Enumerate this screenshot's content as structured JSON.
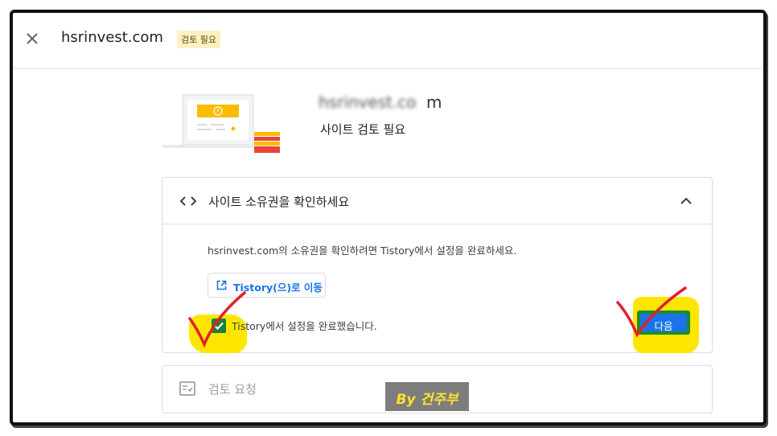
{
  "header": {
    "site": "hsrinvest.com",
    "badge": "검토 필요"
  },
  "hero": {
    "domain_obscured": "hsrinvest.co",
    "domain_tail": "m",
    "subtitle": "사이트 검토 필요"
  },
  "ownership_card": {
    "title": "사이트 소유권을 확인하세요",
    "description": "hsrinvest.com의 소유권을 확인하려면 Tistory에서 설정을 완료하세요.",
    "goto_button": "Tistory(으)로 이동",
    "checkbox_label": "Tistory에서 설정을 완료했습니다.",
    "checkbox_checked": true,
    "next_button": "다음"
  },
  "review_card": {
    "title": "검토 요청"
  },
  "watermark": "By 건주부",
  "colors": {
    "accent_blue": "#1a73e8",
    "highlight_yellow": "#ffe600",
    "annotation_red": "#e0202a",
    "check_green": "#188038"
  },
  "icons": [
    "close-icon",
    "code-icon",
    "chevron-up-icon",
    "open-in-new-icon",
    "check-icon",
    "rate-review-icon"
  ]
}
